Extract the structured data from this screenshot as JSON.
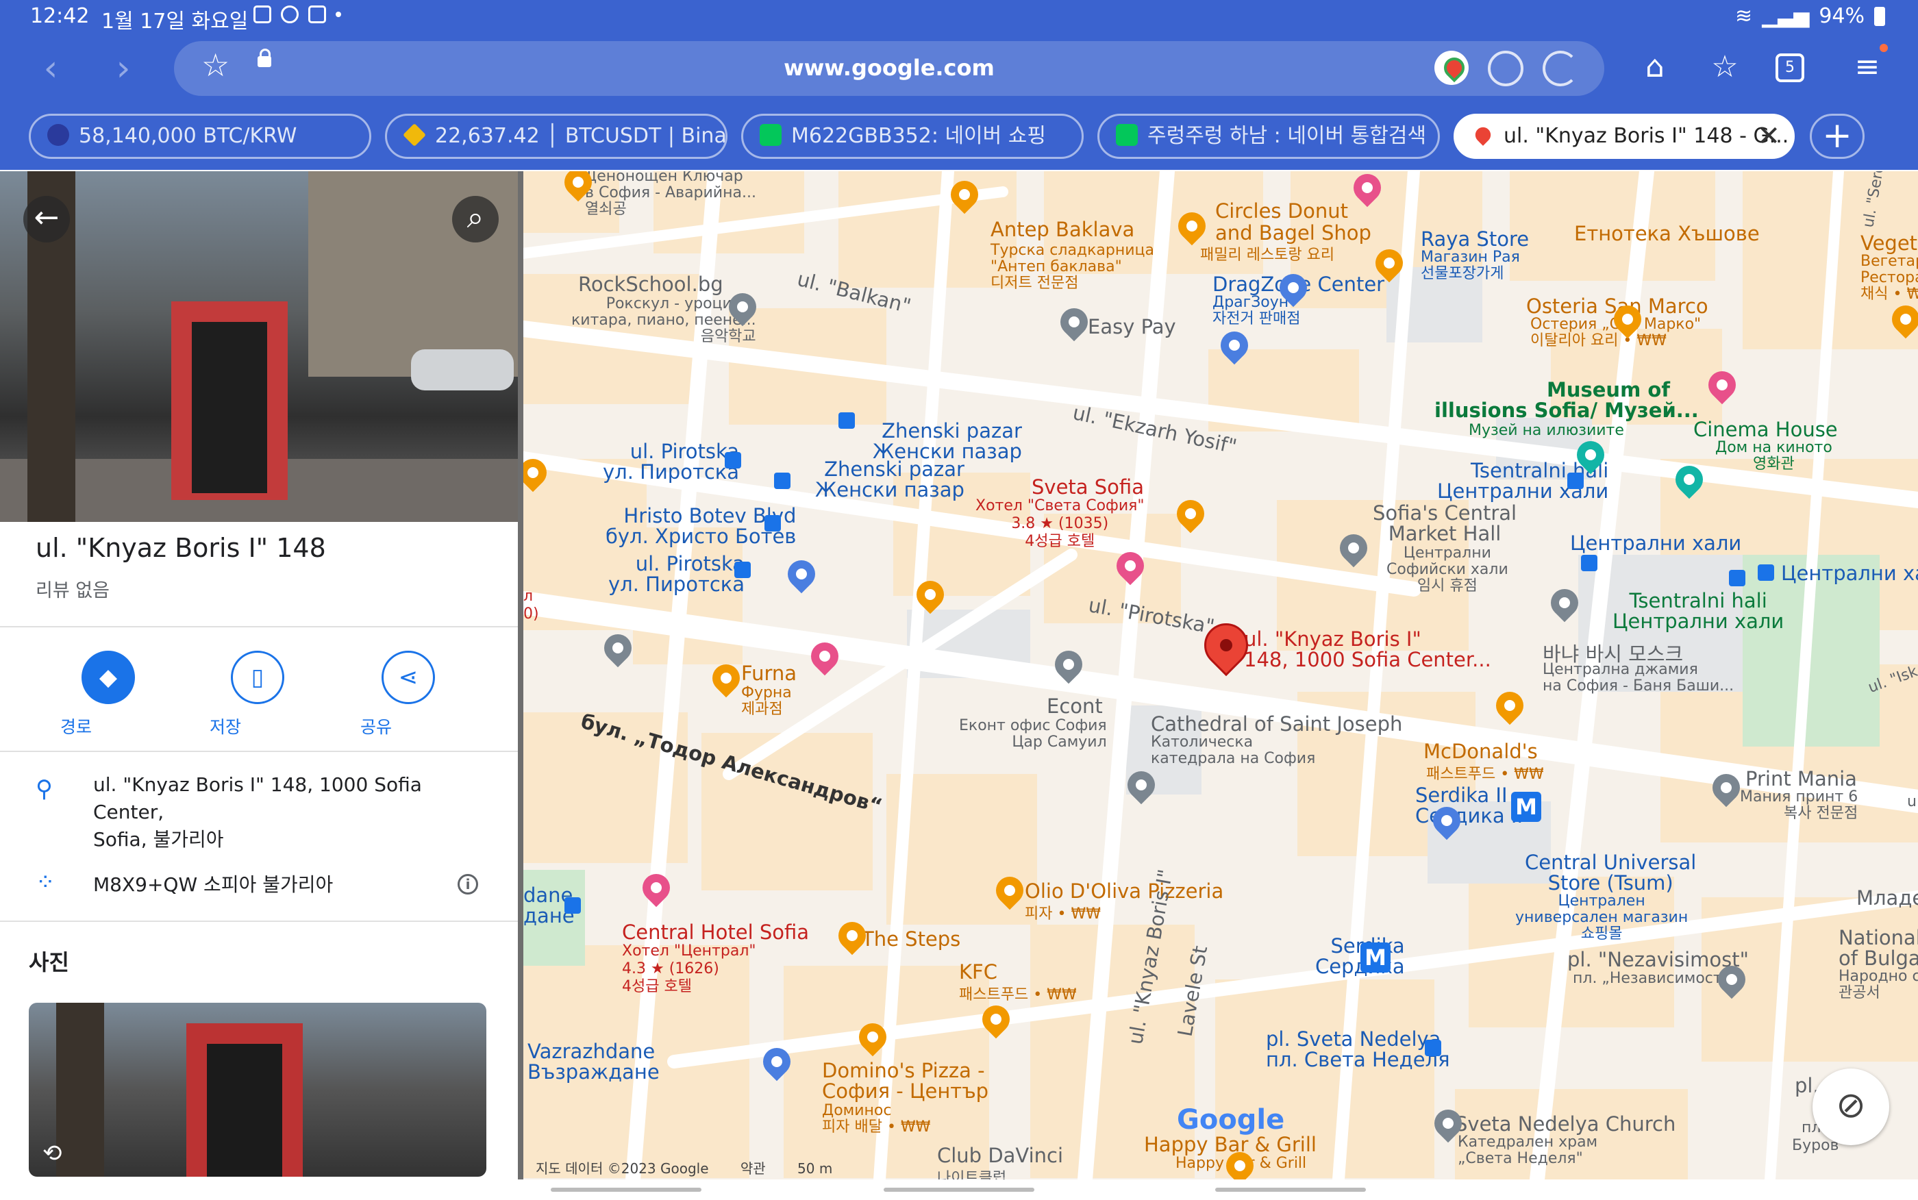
{
  "status_bar": {
    "time": "12:42",
    "date": "1월 17일 화요일",
    "battery": "94%"
  },
  "browser": {
    "url": "www.google.com",
    "tab_count": "5",
    "tabs": [
      {
        "label": "58,140,000 BTC/KRW",
        "icon": "up-icon"
      },
      {
        "label": "22,637.42 │ BTCUSDT | Bina...",
        "icon": "binance-icon"
      },
      {
        "label": "M622GBB352: 네이버 쇼핑",
        "icon": "naver-shopping-icon"
      },
      {
        "label": "주렁주렁 하남 : 네이버 통합검색",
        "icon": "naver-icon"
      },
      {
        "label": "ul. \"Knyaz Boris I\" 148 - G...",
        "icon": "maps-icon",
        "active": true
      }
    ]
  },
  "place": {
    "title": "ul. \"Knyaz Boris I\" 148",
    "reviews": "리뷰 없음",
    "actions": [
      {
        "label": "경로"
      },
      {
        "label": "저장"
      },
      {
        "label": "공유"
      }
    ],
    "address_lines": [
      "ul. \"Knyaz Boris I\" 148, 1000 Sofia Center,",
      "Sofia, 불가리아"
    ],
    "plus_code": "M8X9+QW 소피아 불가리아",
    "photos_heading": "사진"
  },
  "map": {
    "streets": {
      "balkan": "ul. \"Balkan\"",
      "ekzarh": "ul. \"Ekzarh Yosif\"",
      "pirotska": "ul. \"Pirotska\"",
      "todor": "бул. „Тодор Александров“",
      "knyaz": "ul. \"Knyaz Boris I\"",
      "lavele": "Lavele St",
      "serdi": "ul. \"Serdi",
      "isk": "ul. \"Isk",
      "u": "u"
    },
    "labels": {
      "denonosht": [
        "Денонощен Ключар",
        "в София - Аварийна...",
        "열쇠공"
      ],
      "antep": [
        "Antep Baklava",
        "Турска сладкарница",
        "\"Антеп баклава\"",
        "디저트 전문점"
      ],
      "circles": [
        "Circles Donut",
        "and Bagel Shop",
        "패밀리 레스토랑 요리"
      ],
      "raya": [
        "Raya Store",
        "Магазин Рая",
        "선물포장가게"
      ],
      "etnoteka": "Етнотека Хъшове",
      "vegeta": [
        "Vegeta",
        "Вегетар",
        "Ресторан",
        "채식 • ₩"
      ],
      "rockschool": [
        "RockSchool.bg",
        "Рокскул - уроци по",
        "китара, пиано, пеене...",
        "음악학교"
      ],
      "easypay": "Easy Pay",
      "dragzone": [
        "DragZone Center",
        "ДрагЗоун",
        "자전거 판매점"
      ],
      "osteria": [
        "Osteria San Marco",
        "Остерия „Сан Марко\"",
        "이탈리아 요리 • ₩₩"
      ],
      "museum": [
        "Museum of",
        "illusions Sofia/ Музей...",
        "Музей на илюзиите"
      ],
      "cinema": [
        "Cinema House",
        "Дом на киното",
        "영화관"
      ],
      "pirotska1": [
        "ul. Pirotska",
        "ул. Пиротска"
      ],
      "zhenski1": [
        "Zhenski pazar",
        "Женски пазар"
      ],
      "zhenski2": [
        "Zhenski pazar",
        "Женски пазар"
      ],
      "tsentralni1": [
        "Tsentralni hali",
        "Централни хали"
      ],
      "hristo": [
        "Hristo Botev Blvd",
        "бул. Христо Ботев"
      ],
      "svetasofia": [
        "Sveta Sofia",
        "Хотел \"Света София\"",
        "3.8 ★ (1035)",
        "4성급 호텔"
      ],
      "centralmarket": [
        "Sofia's Central",
        "Market Hall",
        "Централни",
        "Софийски хали",
        "임시 휴점"
      ],
      "centralnihali": "Централни хали",
      "centralnihali2": "Централни ха",
      "pirotska2": [
        "ul. Pirotska",
        "ул. Пиротска"
      ],
      "tsentralni2": [
        "Tsentralni hali",
        "Централни хали"
      ],
      "banya": [
        "바냐 바시 모스크",
        "Централна джамия",
        "на София - Баня Баши..."
      ],
      "marker": [
        "ul. \"Knyaz Boris I\"",
        "148, 1000 Sofia Center..."
      ],
      "furna": [
        "Furna",
        "Фурна",
        "제과점"
      ],
      "econt": [
        "Econt",
        "Еконт офис София",
        "Цар Самуил"
      ],
      "cathedral": [
        "Cathedral of Saint Joseph",
        "Католическа",
        "катедрала на София"
      ],
      "mcdonalds": [
        "McDonald's",
        "패스트푸드 • ₩₩"
      ],
      "print": [
        "Print Mania",
        "Мания принт 6",
        "복사 전문점"
      ],
      "serdika1": [
        "Serdika II",
        "Сердика II"
      ],
      "olio": [
        "Olio D'Oliva Pizzeria",
        "피자 • ₩₩"
      ],
      "tsum": [
        "Central Universal",
        "Store (Tsum)",
        "Централен",
        "универсален магазин",
        "쇼핑몰"
      ],
      "mlade": "Младе",
      "national": [
        "National",
        "of Bulgar",
        "Народно с",
        "관공서"
      ],
      "dane": [
        "dane",
        "дане"
      ],
      "centralhotel": [
        "Central Hotel Sofia",
        "Хотел \"Централ\"",
        "4.3 ★ (1626)",
        "4성급 호텔"
      ],
      "steps": "The Steps",
      "kfc": [
        "KFC",
        "패스트푸드 • ₩₩"
      ],
      "serdika2": [
        "Serdika",
        "Сердика"
      ],
      "nezavisimost": [
        "pl. \"Nezavisimost\"",
        "пл. „Независимост\""
      ],
      "vazrazhdane": [
        "Vazrazhdane",
        "Възраждане"
      ],
      "dominos": [
        "Domino's Pizza -",
        "София - Център",
        "Доминос",
        "피자 배달 • ₩₩"
      ],
      "nedelya": [
        "pl. Sveta Nedelya",
        "пл. Света Неделя"
      ],
      "pl": "pl.",
      "pl2": "пл.",
      "burov": "Буров",
      "nedelya_church": [
        "Sveta Nedelya Church",
        "Катедрален храм",
        "„Света Неделя\""
      ],
      "happybar": [
        "Happy Bar & Grill",
        "Happy Bar & Grill"
      ],
      "davinci": [
        "Club DaVinci",
        "나이트클럽"
      ],
      "edge1": "л",
      "edge2": "0)"
    },
    "google_logo": "Google",
    "attribution": "지도 데이터 ©2023 Google",
    "terms": "약관",
    "scale": "50 m"
  }
}
